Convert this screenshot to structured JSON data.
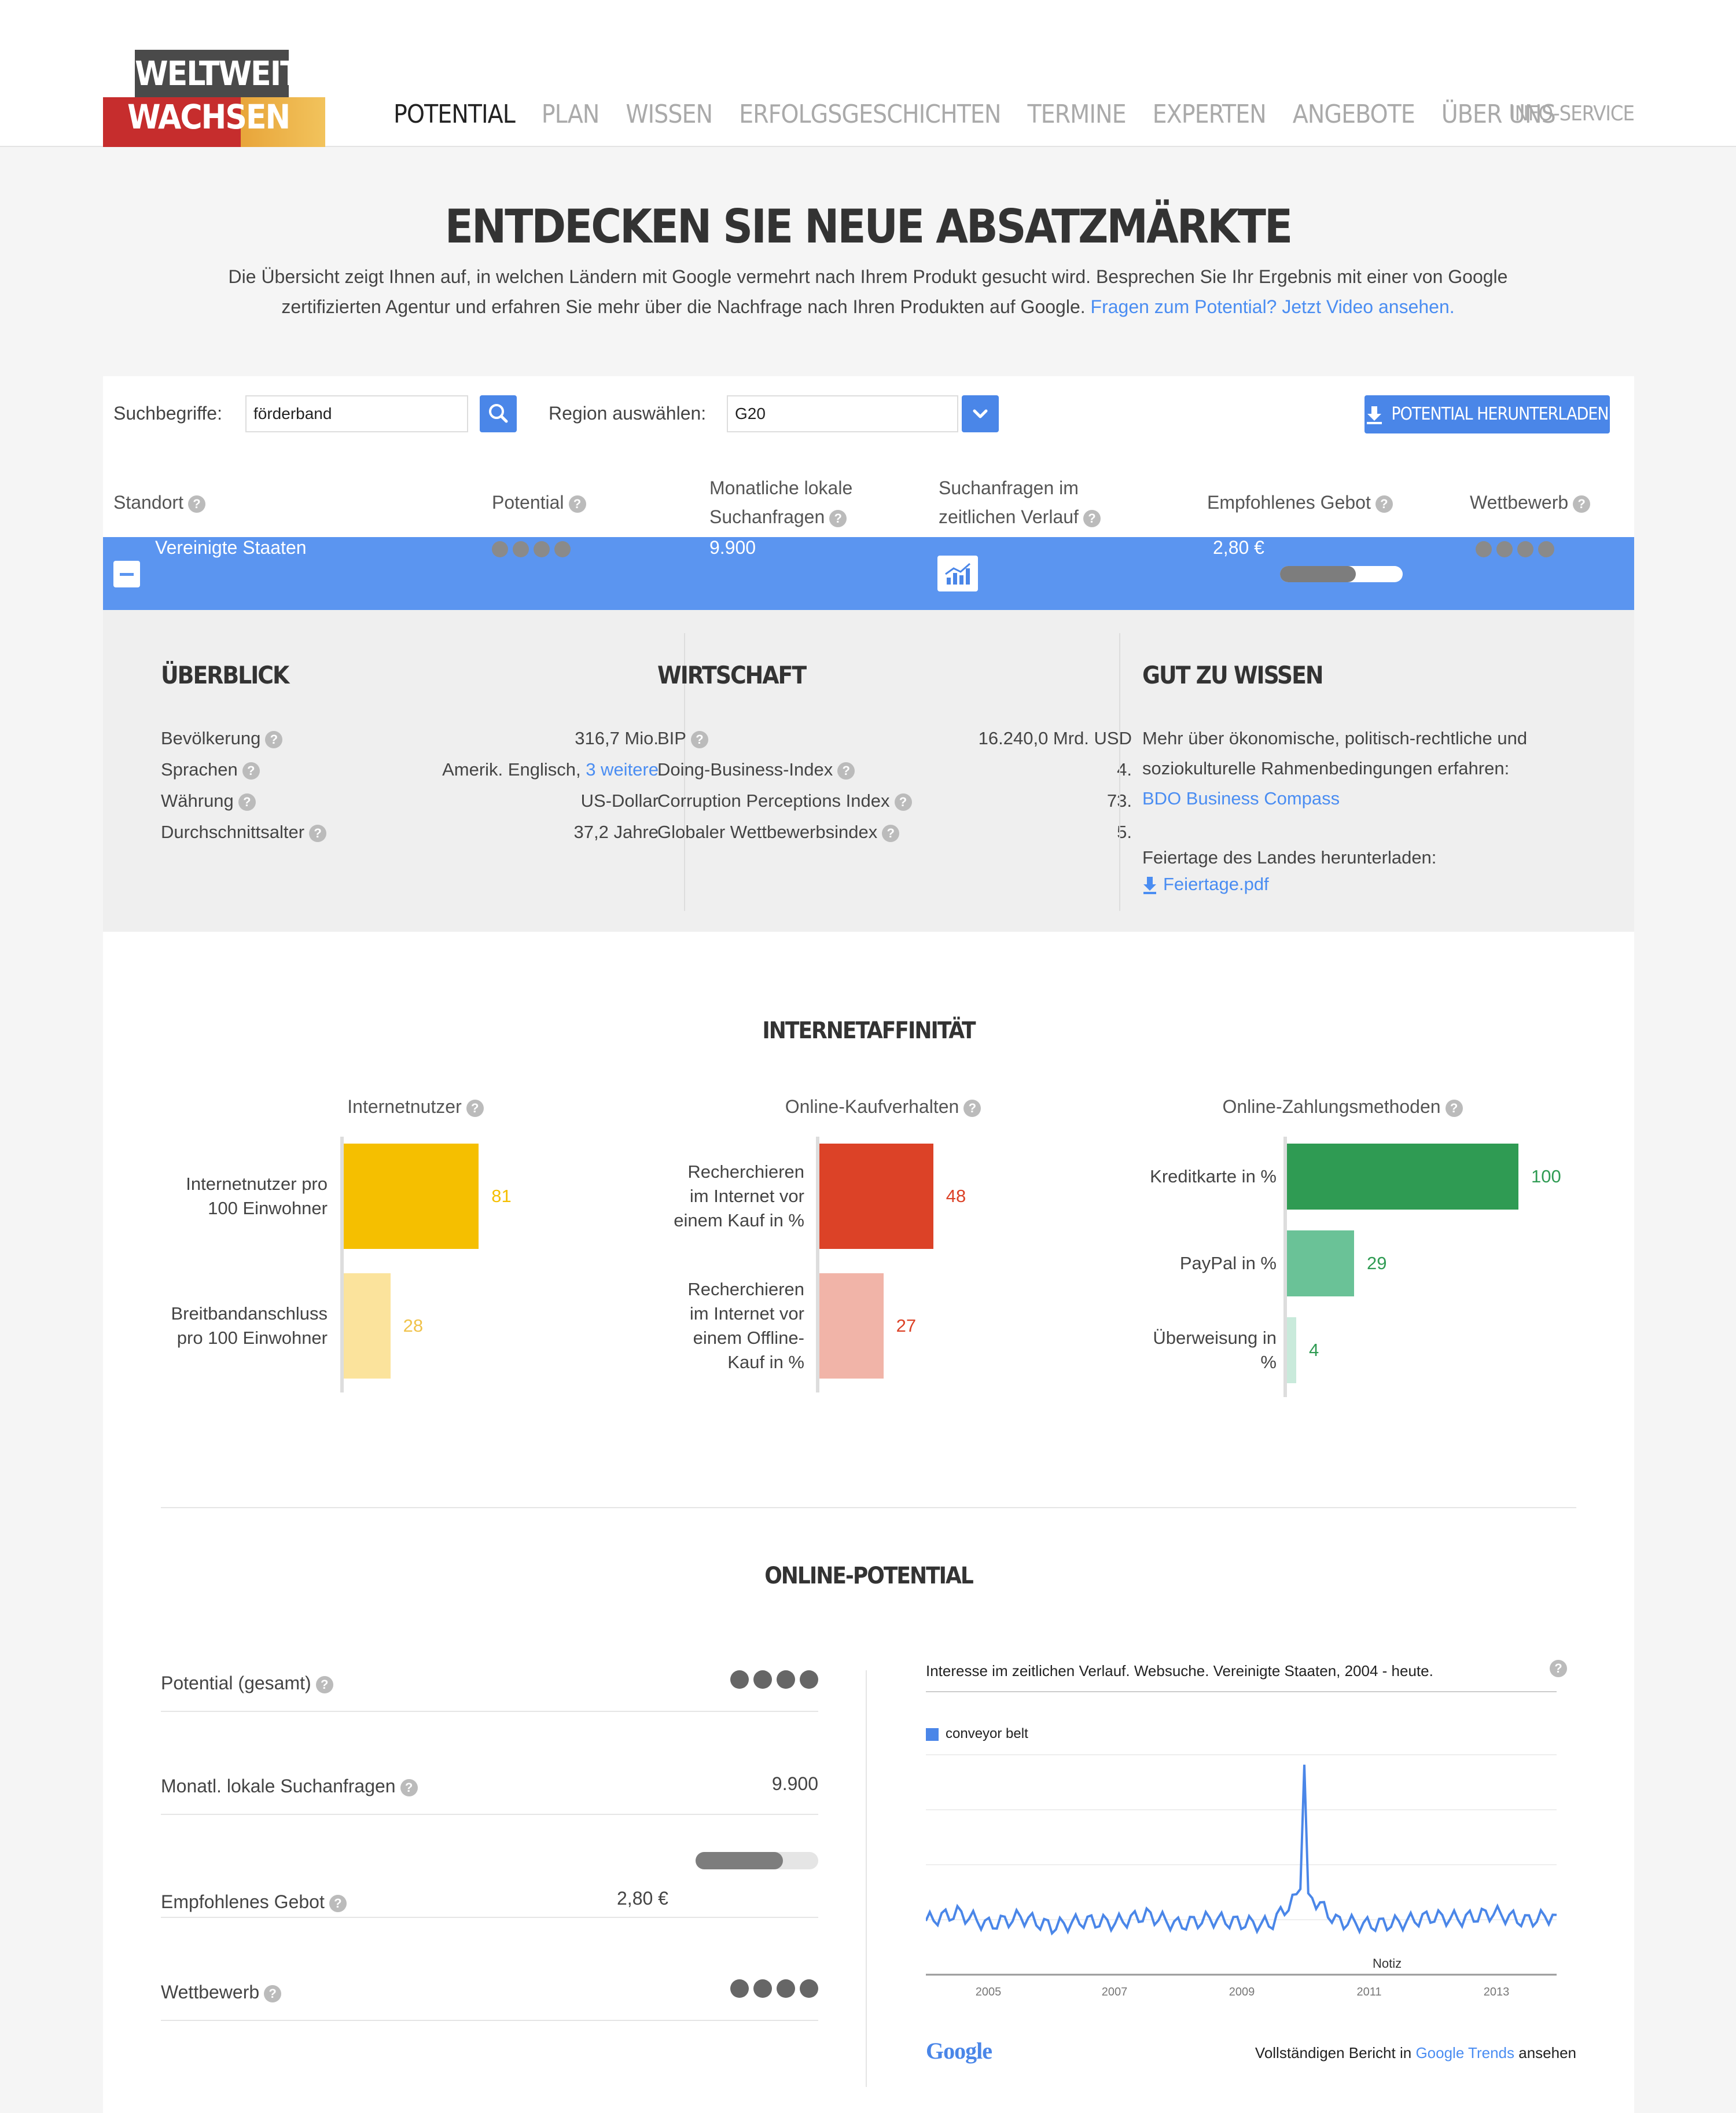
{
  "header": {
    "logo_top": "WELTWEIT",
    "logo_bottom": "WACHSEN",
    "nav": [
      "POTENTIAL",
      "PLAN",
      "WISSEN",
      "ERFOLGSGESCHICHTEN",
      "TERMINE",
      "EXPERTEN",
      "ANGEBOTE",
      "ÜBER UNS"
    ],
    "active_nav": "POTENTIAL",
    "info_service": "INFO-SERVICE"
  },
  "intro": {
    "title": "ENTDECKEN SIE NEUE ABSATZMÄRKTE",
    "text": "Die Übersicht zeigt Ihnen auf, in welchen Ländern mit Google vermehrt nach Ihrem Produkt gesucht wird. Besprechen Sie Ihr Ergebnis mit einer von Google zertifizierten Agentur und erfahren Sie mehr über die Nachfrage nach Ihren Produkten auf Google.",
    "link": "Fragen zum Potential? Jetzt Video ansehen."
  },
  "search": {
    "label": "Suchbegriffe:",
    "value": "förderband",
    "region_label": "Region auswählen:",
    "region_value": "G20",
    "download_label": "POTENTIAL HERUNTERLADEN"
  },
  "table": {
    "headers": {
      "standort": "Standort",
      "potential": "Potential",
      "monthly_1": "Monatliche lokale",
      "monthly_2": "Suchanfragen",
      "trend_1": "Suchanfragen im",
      "trend_2": "zeitlichen Verlauf",
      "bid": "Empfohlenes Gebot",
      "competition": "Wettbewerb"
    },
    "row": {
      "country": "Vereinigte Staaten",
      "potential_level": 4,
      "monthly": "9.900",
      "bid": "2,80 €",
      "bid_fraction": 0.62,
      "competition_level": 4
    }
  },
  "overview": {
    "title": "ÜBERBLICK",
    "rows": [
      {
        "label": "Bevölkerung",
        "value": "316,7 Mio."
      },
      {
        "label": "Sprachen",
        "value": "Amerik. Englisch,",
        "link": "3 weitere"
      },
      {
        "label": "Währung",
        "value": "US-Dollar"
      },
      {
        "label": "Durchschnittsalter",
        "value": "37,2 Jahre"
      }
    ]
  },
  "economy": {
    "title": "WIRTSCHAFT",
    "rows": [
      {
        "label": "BIP",
        "value": "16.240,0 Mrd. USD"
      },
      {
        "label": "Doing-Business-Index",
        "value": "4."
      },
      {
        "label": "Corruption Perceptions Index",
        "value": "73."
      },
      {
        "label": "Globaler Wettbewerbsindex",
        "value": "5."
      }
    ]
  },
  "good_to_know": {
    "title": "GUT ZU WISSEN",
    "text1": "Mehr über ökonomische, politisch-rechtliche und",
    "text2": "soziokulturelle Rahmenbedingungen erfahren:",
    "link1": "BDO Business Compass",
    "text3": "Feiertage des Landes herunterladen:",
    "link2": "Feiertage.pdf"
  },
  "internet": {
    "title": "INTERNETAFFINITÄT",
    "charts": [
      {
        "title": "Internetnutzer",
        "bars": [
          {
            "label": [
              "Internetnutzer pro",
              "100 Einwohner"
            ],
            "value": 81,
            "color": "#f5bf00",
            "vcolor": "#f5bf00"
          },
          {
            "label": [
              "Breitbandanschluss",
              "pro 100 Einwohner"
            ],
            "value": 28,
            "color": "#fbe39c",
            "vcolor": "#f0c24a"
          }
        ]
      },
      {
        "title": "Online-Kaufverhalten",
        "bars": [
          {
            "label": [
              "Recherchieren",
              "im Internet vor",
              "einem Kauf in %"
            ],
            "value": 48,
            "color": "#dc4227",
            "vcolor": "#dc4227"
          },
          {
            "label": [
              "Recherchieren",
              "im Internet vor",
              "einem Offline-",
              "Kauf in %"
            ],
            "value": 27,
            "color": "#f1b4a8",
            "vcolor": "#dc4227"
          }
        ]
      },
      {
        "title": "Online-Zahlungsmethoden",
        "bars": [
          {
            "label": [
              "Kreditkarte in %"
            ],
            "value": 100,
            "color": "#2f9b53",
            "vcolor": "#2f9b53"
          },
          {
            "label": [
              "PayPal in %"
            ],
            "value": 29,
            "color": "#6ac297",
            "vcolor": "#2f9b53"
          },
          {
            "label": [
              "Überweisung in",
              "%"
            ],
            "value": 4,
            "color": "#c9eadb",
            "vcolor": "#2f9b53"
          }
        ]
      }
    ]
  },
  "online_potential": {
    "title": "ONLINE-POTENTIAL",
    "potential_label": "Potential (gesamt)",
    "potential_level": 4,
    "monthly_label": "Monatl. lokale Suchanfragen",
    "monthly_value": "9.900",
    "bid_label": "Empfohlenes Gebot",
    "bid_value": "2,80 €",
    "bid_fraction": 0.71,
    "competition_label": "Wettbewerb",
    "competition_level": 4
  },
  "trends": {
    "title": "Interesse im zeitlichen Verlauf. Websuche. Vereinigte Staaten, 2004 - heute.",
    "legend": "conveyor belt",
    "note": "Notiz",
    "years": [
      "2005",
      "2007",
      "2009",
      "2011",
      "2013"
    ],
    "footer_pre": "Vollständigen Bericht in",
    "footer_link": "Google Trends",
    "footer_post": "ansehen",
    "brand": "Google"
  },
  "chart_data": {
    "type": "line",
    "x": [
      "2004",
      "2004.5",
      "2005",
      "2005.5",
      "2006",
      "2006.5",
      "2007",
      "2007.5",
      "2008",
      "2008.5",
      "2009",
      "2009.5",
      "2010",
      "2010.5",
      "2011",
      "2011.5",
      "2012",
      "2012.5",
      "2013",
      "2013.5",
      "2014"
    ],
    "series": [
      {
        "name": "conveyor belt",
        "values": [
          20,
          24,
          18,
          22,
          17,
          20,
          19,
          23,
          18,
          21,
          19,
          18,
          100,
          20,
          18,
          19,
          22,
          21,
          24,
          20,
          23
        ]
      }
    ],
    "ylim": [
      0,
      100
    ]
  }
}
